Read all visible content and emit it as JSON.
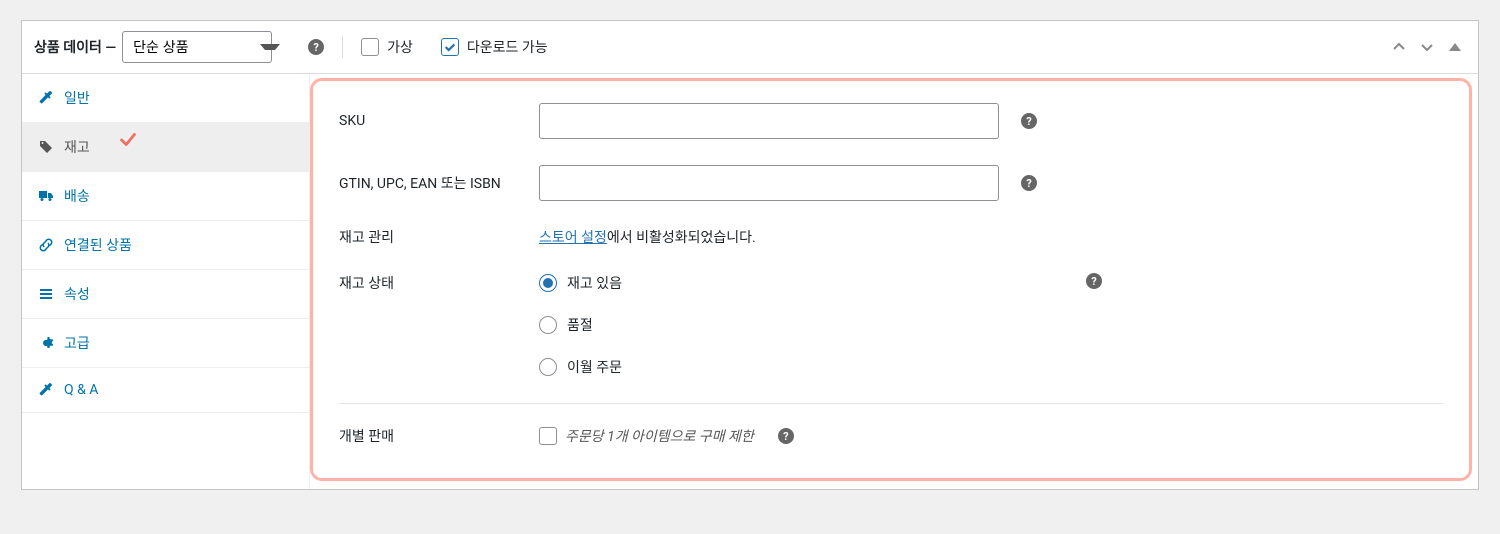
{
  "header": {
    "title": "상품 데이터 —",
    "product_type": "단순 상품",
    "virtual_label": "가상",
    "downloadable_label": "다운로드 가능",
    "virtual_checked": false,
    "downloadable_checked": true
  },
  "sidebar": {
    "items": [
      {
        "key": "general",
        "label": "일반",
        "icon": "wrench-icon"
      },
      {
        "key": "inventory",
        "label": "재고",
        "icon": "tag-icon",
        "active": true,
        "annotated": true
      },
      {
        "key": "shipping",
        "label": "배송",
        "icon": "truck-icon"
      },
      {
        "key": "linked",
        "label": "연결된 상품",
        "icon": "link-icon"
      },
      {
        "key": "attributes",
        "label": "속성",
        "icon": "list-icon"
      },
      {
        "key": "advanced",
        "label": "고급",
        "icon": "gear-icon"
      },
      {
        "key": "qa",
        "label": "Q & A",
        "icon": "wrench-icon"
      }
    ]
  },
  "content": {
    "sku_label": "SKU",
    "sku_value": "",
    "gtin_label": "GTIN, UPC, EAN 또는 ISBN",
    "gtin_value": "",
    "stock_mgmt_label": "재고 관리",
    "stock_mgmt_link": "스토어 설정",
    "stock_mgmt_text": "에서 비활성화되었습니다.",
    "stock_status_label": "재고 상태",
    "stock_status_options": [
      {
        "label": "재고 있음",
        "value": "instock",
        "checked": true
      },
      {
        "label": "품절",
        "value": "outofstock",
        "checked": false
      },
      {
        "label": "이월 주문",
        "value": "onbackorder",
        "checked": false
      }
    ],
    "sold_individually_label": "개별 판매",
    "sold_individually_checkbox_label": "주문당 1개 아이템으로 구매 제한",
    "sold_individually_checked": false
  }
}
